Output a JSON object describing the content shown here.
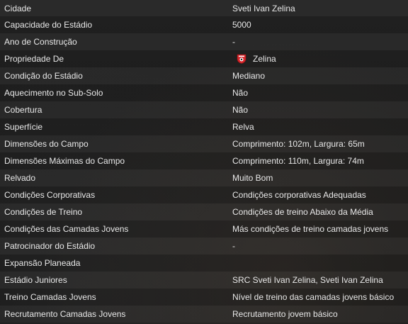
{
  "stadium_info": {
    "rows": [
      {
        "label": "Cidade",
        "value": "Sveti Ivan Zelina"
      },
      {
        "label": "Capacidade do Estádio",
        "value": "5000"
      },
      {
        "label": "Ano de Construção",
        "value": "-"
      },
      {
        "label": "Propriedade De",
        "value": "Zelina",
        "icon": "club-crest-icon"
      },
      {
        "label": "Condição do Estádio",
        "value": "Mediano"
      },
      {
        "label": "Aquecimento no Sub-Solo",
        "value": "Não"
      },
      {
        "label": "Cobertura",
        "value": "Não"
      },
      {
        "label": "Superfície",
        "value": "Relva"
      },
      {
        "label": "Dimensões do Campo",
        "value": "Comprimento: 102m, Largura: 65m"
      },
      {
        "label": "Dimensões Máximas do Campo",
        "value": "Comprimento: 110m, Largura: 74m"
      },
      {
        "label": "Relvado",
        "value": "Muito Bom"
      },
      {
        "label": "Condições Corporativas",
        "value": "Condições corporativas Adequadas"
      },
      {
        "label": "Condições de Treino",
        "value": "Condições de treino Abaixo da Média"
      },
      {
        "label": "Condições das Camadas Jovens",
        "value": "Más condições de treino camadas jovens"
      },
      {
        "label": "Patrocinador do Estádio",
        "value": "-"
      },
      {
        "label": "Expansão Planeada",
        "value": ""
      },
      {
        "label": "Estádio Juniores",
        "value": "SRC Sveti Ivan Zelina, Sveti Ivan Zelina"
      },
      {
        "label": "Treino Camadas Jovens",
        "value": "Nível de treino das camadas jovens básico"
      },
      {
        "label": "Recrutamento Camadas Jovens",
        "value": "Recrutamento jovem básico"
      }
    ]
  },
  "colors": {
    "crest_red": "#d8262b",
    "crest_white": "#ffffff",
    "text": "#e8e8e8"
  }
}
